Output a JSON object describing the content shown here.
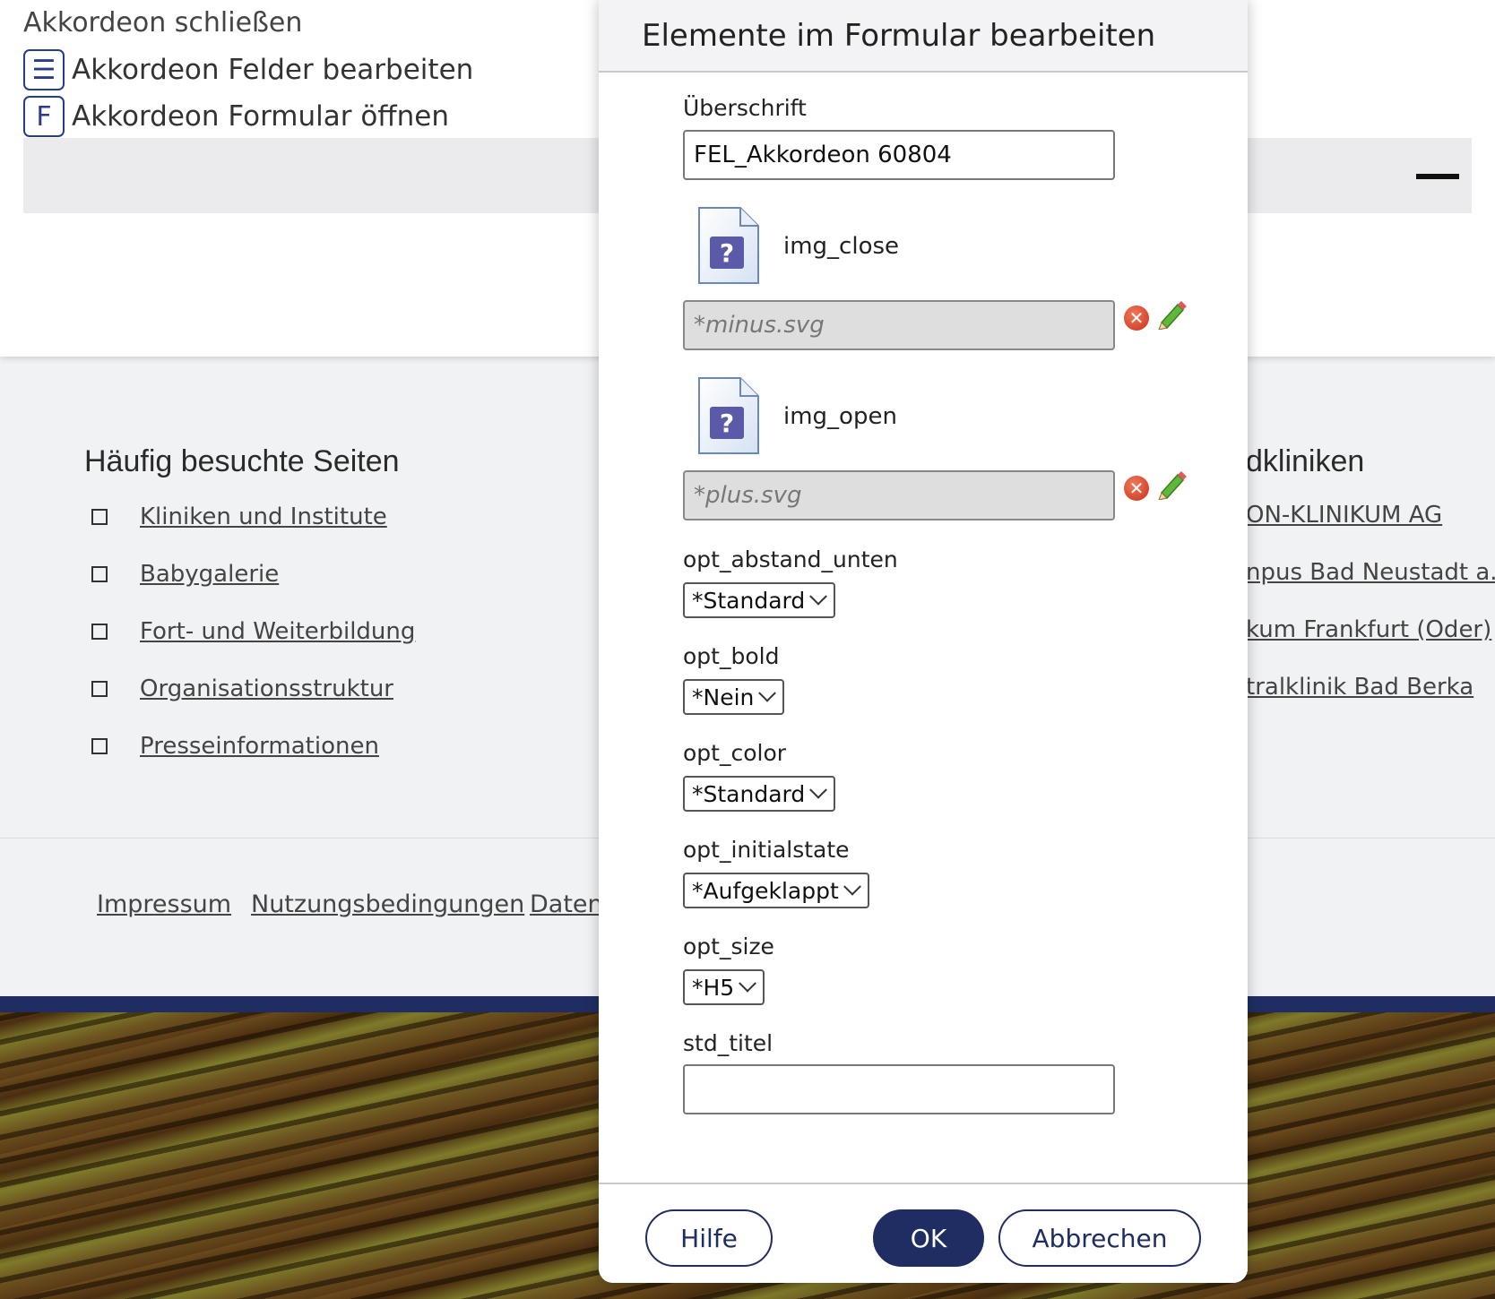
{
  "page": {
    "accordion": {
      "close_label": "Akkordeon schließen",
      "edit_fields_icon": "☰",
      "edit_fields_label": "Akkordeon Felder bearbeiten",
      "open_form_icon": "F",
      "open_form_label": "Akkordeon Formular öffnen"
    },
    "footer": {
      "popular_heading": "Häufig besuchte Seiten",
      "popular_links": [
        "Kliniken und Institute",
        "Babygalerie",
        "Fort- und Weiterbildung",
        "Organisationsstruktur",
        "Presseinformationen"
      ],
      "clinics_heading": "dkliniken",
      "clinics_links": [
        "ON-KLINIKUM AG",
        "npus Bad Neustadt a.d. S",
        "kum Frankfurt (Oder)",
        "tralklinik Bad Berka"
      ],
      "legal_links": [
        "Impressum",
        "Nutzungsbedingungen",
        "Datens"
      ]
    }
  },
  "dialog": {
    "title": "Elemente im Formular bearbeiten",
    "heading_label": "Überschrift",
    "heading_value": "FEL_Akkordeon 60804",
    "img_close": {
      "label": "img_close",
      "value": "*minus.svg"
    },
    "img_open": {
      "label": "img_open",
      "value": "*plus.svg"
    },
    "opt_abstand_unten": {
      "label": "opt_abstand_unten",
      "value": "*Standard"
    },
    "opt_bold": {
      "label": "opt_bold",
      "value": "*Nein"
    },
    "opt_color": {
      "label": "opt_color",
      "value": "*Standard"
    },
    "opt_initialstate": {
      "label": "opt_initialstate",
      "value": "*Aufgeklappt"
    },
    "opt_size": {
      "label": "opt_size",
      "value": "*H5"
    },
    "std_titel": {
      "label": "std_titel",
      "value": ""
    },
    "buttons": {
      "help": "Hilfe",
      "ok": "OK",
      "cancel": "Abbrechen"
    },
    "icons": {
      "file_preview": "unknown-file-icon",
      "delete": "delete-icon",
      "edit": "pencil-icon"
    }
  },
  "colors": {
    "brand_navy": "#1f2d63",
    "accent_blue": "#283d8a",
    "page_gray": "#f1f2f4"
  }
}
